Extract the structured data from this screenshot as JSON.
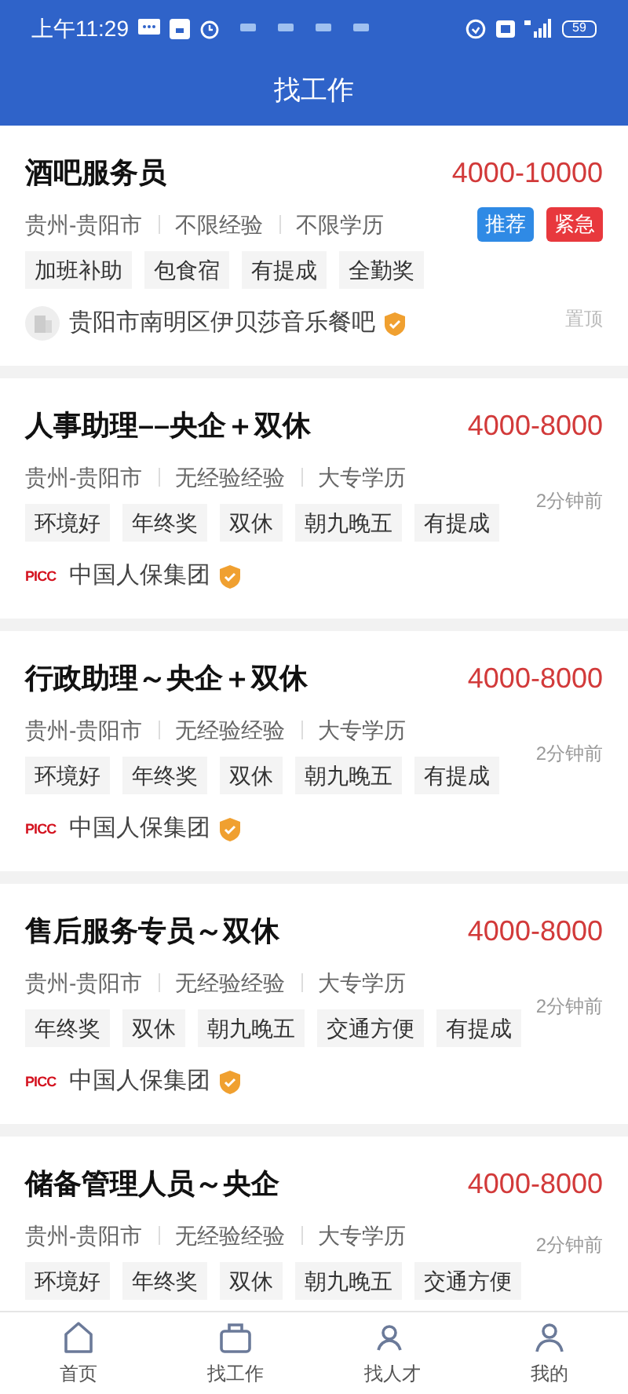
{
  "status_bar": {
    "time": "上午11:29",
    "battery": "59"
  },
  "header": {
    "title": "找工作"
  },
  "jobs": [
    {
      "title": "酒吧服务员",
      "salary": "4000-10000",
      "location": "贵州-贵阳市",
      "experience": "不限经验",
      "education": "不限学历",
      "badges": [
        {
          "label": "推荐",
          "kind": "recommend"
        },
        {
          "label": "紧急",
          "kind": "urgent"
        }
      ],
      "tags": [
        "加班补助",
        "包食宿",
        "有提成",
        "全勤奖"
      ],
      "company": "贵阳市南明区伊贝莎音乐餐吧",
      "logo": {
        "kind": "building"
      },
      "verified": true,
      "note": "置顶"
    },
    {
      "title": "人事助理––央企＋双休",
      "salary": "4000-8000",
      "location": "贵州-贵阳市",
      "experience": "无经验经验",
      "education": "大专学历",
      "tags": [
        "环境好",
        "年终奖",
        "双休",
        "朝九晚五",
        "有提成"
      ],
      "company": "中国人保集团",
      "logo": {
        "kind": "text",
        "text": "PICC"
      },
      "verified": true,
      "note": "2分钟前"
    },
    {
      "title": "行政助理～央企＋双休",
      "salary": "4000-8000",
      "location": "贵州-贵阳市",
      "experience": "无经验经验",
      "education": "大专学历",
      "tags": [
        "环境好",
        "年终奖",
        "双休",
        "朝九晚五",
        "有提成"
      ],
      "company": "中国人保集团",
      "logo": {
        "kind": "text",
        "text": "PICC"
      },
      "verified": true,
      "note": "2分钟前"
    },
    {
      "title": "售后服务专员～双休",
      "salary": "4000-8000",
      "location": "贵州-贵阳市",
      "experience": "无经验经验",
      "education": "大专学历",
      "tags": [
        "年终奖",
        "双休",
        "朝九晚五",
        "交通方便",
        "有提成"
      ],
      "company": "中国人保集团",
      "logo": {
        "kind": "text",
        "text": "PICC"
      },
      "verified": true,
      "note": "2分钟前"
    },
    {
      "title": "储备管理人员～央企",
      "salary": "4000-8000",
      "location": "贵州-贵阳市",
      "experience": "无经验经验",
      "education": "大专学历",
      "tags": [
        "环境好",
        "年终奖",
        "双休",
        "朝九晚五",
        "交通方便"
      ],
      "note": "2分钟前"
    }
  ],
  "nav": [
    {
      "label": "首页"
    },
    {
      "label": "找工作"
    },
    {
      "label": "找人才"
    },
    {
      "label": "我的"
    }
  ]
}
